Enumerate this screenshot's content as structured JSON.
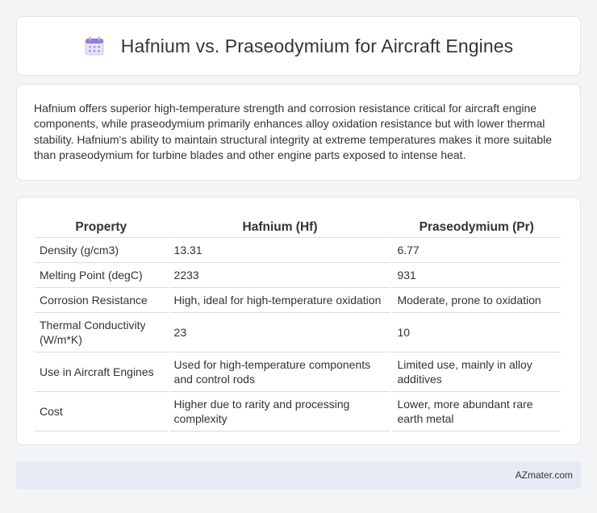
{
  "header": {
    "title": "Hafnium vs. Praseodymium for Aircraft Engines",
    "icon": "calendar-icon"
  },
  "summary": {
    "text": "Hafnium offers superior high-temperature strength and corrosion resistance critical for aircraft engine components, while praseodymium primarily enhances alloy oxidation resistance but with lower thermal stability. Hafnium's ability to maintain structural integrity at extreme temperatures makes it more suitable than praseodymium for turbine blades and other engine parts exposed to intense heat."
  },
  "table": {
    "headers": [
      "Property",
      "Hafnium (Hf)",
      "Praseodymium (Pr)"
    ],
    "rows": [
      [
        "Density (g/cm3)",
        "13.31",
        "6.77"
      ],
      [
        "Melting Point (degC)",
        "2233",
        "931"
      ],
      [
        "Corrosion Resistance",
        "High, ideal for high-temperature oxidation",
        "Moderate, prone to oxidation"
      ],
      [
        "Thermal Conductivity (W/m*K)",
        "23",
        "10"
      ],
      [
        "Use in Aircraft Engines",
        "Used for high-temperature components and control rods",
        "Limited use, mainly in alloy additives"
      ],
      [
        "Cost",
        "Higher due to rarity and processing complexity",
        "Lower, more abundant rare earth metal"
      ]
    ]
  },
  "footer": {
    "brand": "AZmater.com"
  }
}
